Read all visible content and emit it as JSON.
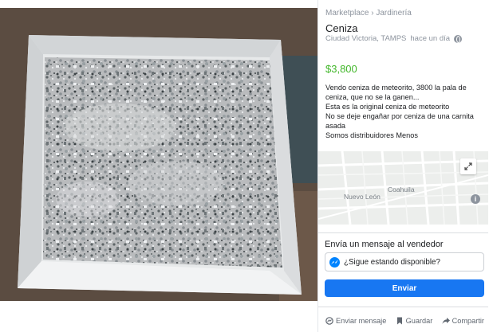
{
  "photo": {
    "icon": "ash-in-box-photo"
  },
  "listing": {
    "breadcrumb": {
      "root": "Marketplace",
      "separator": "›",
      "category": "Jardinería"
    },
    "title": "Ceniza",
    "location": "Ciudad Victoria, TAMPS",
    "time_ago": "hace un día",
    "price": "$3,800",
    "price_color": "#42b72a",
    "description_lines": [
      "Vendo ceniza de meteorito, 3800 la pala de",
      "ceniza, que no se la ganen...",
      "Esta es la original ceniza de meteorito",
      "No se deje engañar por ceniza de una carnita",
      "asada",
      "Somos distribuidores Menos"
    ]
  },
  "map": {
    "labels": [
      "Coahuila",
      "Nuevo León"
    ],
    "expand_icon": "expand-icon",
    "info_icon": "info-icon",
    "info_glyph": "i"
  },
  "message": {
    "heading": "Envía un mensaje al vendedor",
    "input_value": "¿Sigue estando disponible?",
    "send_label": "Enviar",
    "accent": "#1877f2"
  },
  "actions": {
    "message_label": "Enviar mensaje",
    "save_label": "Guardar",
    "share_label": "Compartir"
  }
}
